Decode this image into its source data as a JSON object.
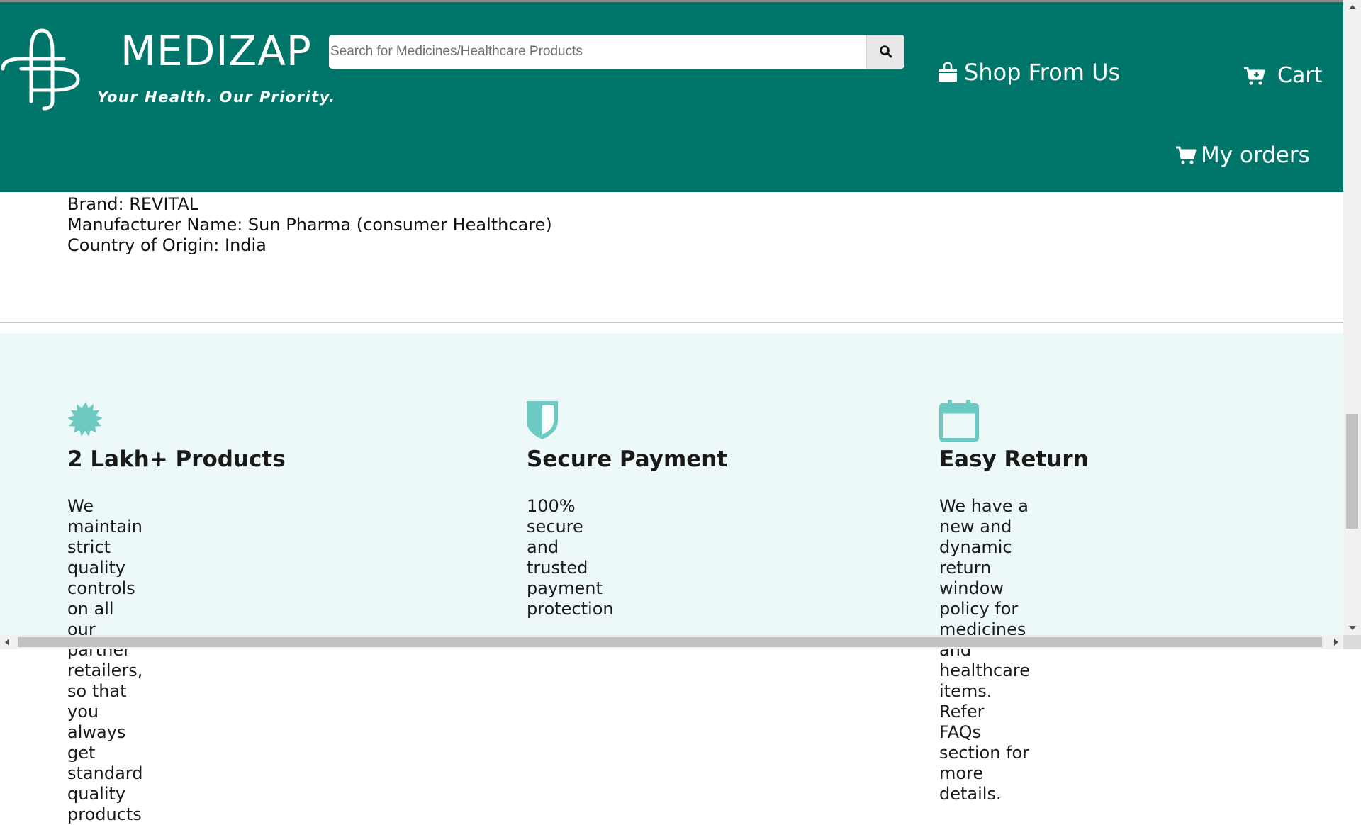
{
  "header": {
    "brand": "MEDIZAP",
    "tagline": "Your Health. Our Priority.",
    "search": {
      "placeholder": "Search for Medicines/Healthcare Products",
      "value": "",
      "button_icon": "search-icon"
    },
    "nav": {
      "shop_label": "Shop From Us",
      "shop_icon": "shopping-bag-icon",
      "cart_label": "Cart",
      "cart_icon": "cart-plus-icon",
      "orders_label": "My orders",
      "orders_icon": "cart-icon"
    },
    "background_color": "#00766b"
  },
  "product_details": {
    "brand": "Brand: REVITAL",
    "manufacturer": "Manufacturer Name: Sun Pharma (consumer Healthcare)",
    "origin": "Country of Origin: India"
  },
  "features": {
    "background_color": "#edf8f9",
    "icon_color": "#6ccac2",
    "items": [
      {
        "icon": "badge-icon",
        "title": "2 Lakh+ Products",
        "lines": [
          "We maintain strict quality",
          "controls on all our partner",
          "retailers, so that you always",
          "get standard quality",
          "products"
        ]
      },
      {
        "icon": "shield-icon",
        "title": "Secure Payment",
        "lines": [
          "100% secure and trusted",
          "payment protection"
        ]
      },
      {
        "icon": "calendar-icon",
        "title": "Easy Return",
        "lines": [
          "We have a new and dynamic",
          "return window policy for",
          "medicines and healthcare",
          "items. Refer FAQs section for",
          "more details."
        ]
      }
    ]
  }
}
